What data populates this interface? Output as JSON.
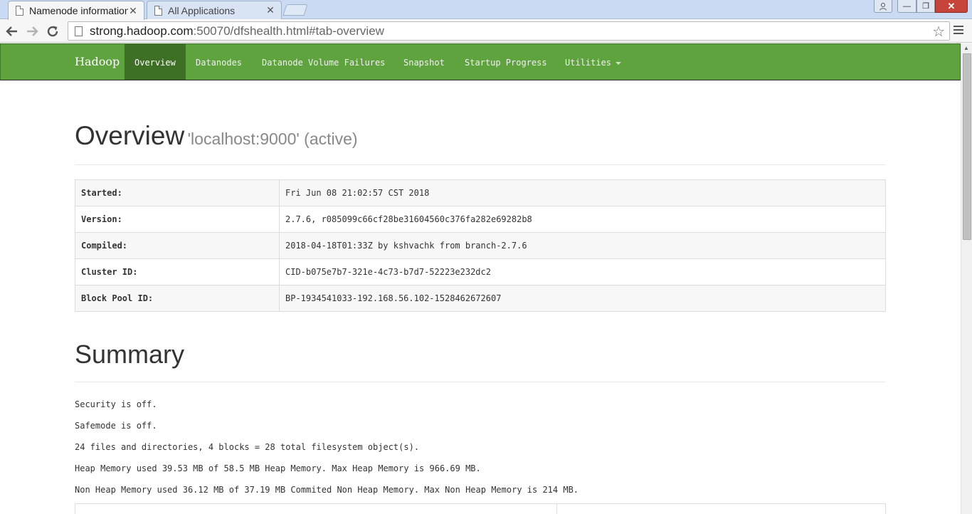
{
  "browser": {
    "tabs": [
      {
        "title": "Namenode information",
        "close": "✕"
      },
      {
        "title": "All Applications",
        "close": "✕"
      }
    ],
    "url_host": "strong.hadoop.com",
    "url_rest": ":50070/dfshealth.html#tab-overview",
    "window_controls": {
      "minimize": "—",
      "maximize": "❐",
      "close": "✕"
    }
  },
  "navbar": {
    "brand": "Hadoop",
    "items": [
      {
        "label": "Overview",
        "active": true
      },
      {
        "label": "Datanodes"
      },
      {
        "label": "Datanode Volume Failures"
      },
      {
        "label": "Snapshot"
      },
      {
        "label": "Startup Progress"
      },
      {
        "label": "Utilities"
      }
    ]
  },
  "overview": {
    "title": "Overview",
    "subtitle": "'localhost:9000' (active)",
    "rows": [
      {
        "key": "Started:",
        "value": "Fri Jun 08 21:02:57 CST 2018"
      },
      {
        "key": "Version:",
        "value": "2.7.6, r085099c66cf28be31604560c376fa282e69282b8"
      },
      {
        "key": "Compiled:",
        "value": "2018-04-18T01:33Z by kshvachk from branch-2.7.6"
      },
      {
        "key": "Cluster ID:",
        "value": "CID-b075e7b7-321e-4c73-b7d7-52223e232dc2"
      },
      {
        "key": "Block Pool ID:",
        "value": "BP-1934541033-192.168.56.102-1528462672607"
      }
    ]
  },
  "summary": {
    "title": "Summary",
    "lines": [
      "Security is off.",
      "Safemode is off.",
      "24 files and directories, 4 blocks = 28 total filesystem object(s).",
      "Heap Memory used 39.53 MB of 58.5 MB Heap Memory. Max Heap Memory is 966.69 MB.",
      "Non Heap Memory used 36.12 MB of 37.19 MB Commited Non Heap Memory. Max Non Heap Memory is 214 MB."
    ]
  },
  "icons": {
    "back": "back-arrow-icon",
    "forward": "forward-arrow-icon",
    "reload": "reload-icon",
    "star": "bookmark-star-icon",
    "menu": "hamburger-menu-icon",
    "user": "user-profile-icon"
  },
  "colors": {
    "navbar": "#5fa33e",
    "navbar_active": "#3d6f24",
    "tab_bar": "#c9daf2"
  }
}
